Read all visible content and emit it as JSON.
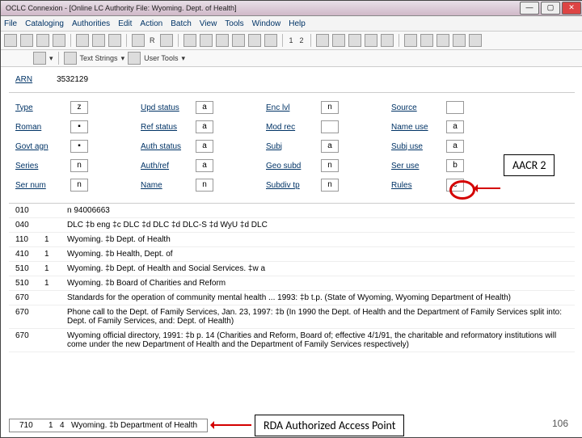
{
  "titlebar": {
    "text": "OCLC Connexion - [Online LC Authority File: Wyoming. Dept. of Health]"
  },
  "menu": {
    "file": "File",
    "cataloging": "Cataloging",
    "authorities": "Authorities",
    "edit": "Edit",
    "action": "Action",
    "batch": "Batch",
    "view": "View",
    "tools": "Tools",
    "window": "Window",
    "help": "Help"
  },
  "toolbar_nums": {
    "one": "1",
    "two": "2"
  },
  "toolbar2": {
    "textstrings": "Text Strings",
    "usertools": "User Tools"
  },
  "arn": {
    "label": "ARN",
    "value": "3532129"
  },
  "ff": {
    "r1": {
      "c1l": "Type",
      "c1v": "z",
      "c2l": "Upd status",
      "c2v": "a",
      "c3l": "Enc lvl",
      "c3v": "n",
      "c4l": "Source",
      "c4v": ""
    },
    "r2": {
      "c1l": "Roman",
      "c1v": "▪",
      "c2l": "Ref status",
      "c2v": "a",
      "c3l": "Mod rec",
      "c3v": "",
      "c4l": "Name use",
      "c4v": "a"
    },
    "r3": {
      "c1l": "Govt agn",
      "c1v": "▪",
      "c2l": "Auth status",
      "c2v": "a",
      "c3l": "Subj",
      "c3v": "a",
      "c4l": "Subj use",
      "c4v": "a"
    },
    "r4": {
      "c1l": "Series",
      "c1v": "n",
      "c2l": "Auth/ref",
      "c2v": "a",
      "c3l": "Geo subd",
      "c3v": "n",
      "c4l": "Ser use",
      "c4v": "b"
    },
    "r5": {
      "c1l": "Ser num",
      "c1v": "n",
      "c2l": "Name",
      "c2v": "n",
      "c3l": "Subdiv tp",
      "c3v": "n",
      "c4l": "Rules",
      "c4v": "c"
    }
  },
  "marc": [
    {
      "tag": "010",
      "i1": "",
      "i2": "",
      "data": "n  94006663"
    },
    {
      "tag": "040",
      "i1": "",
      "i2": "",
      "data": "DLC ‡b eng ‡c DLC ‡d DLC ‡d DLC-S ‡d WyU ‡d DLC"
    },
    {
      "tag": "110",
      "i1": "1",
      "i2": "",
      "data": "Wyoming. ‡b Dept. of Health"
    },
    {
      "tag": "410",
      "i1": "1",
      "i2": "",
      "data": "Wyoming. ‡b Health, Dept. of"
    },
    {
      "tag": "510",
      "i1": "1",
      "i2": "",
      "data": "Wyoming. ‡b Dept. of Health and Social Services. ‡w a"
    },
    {
      "tag": "510",
      "i1": "1",
      "i2": "",
      "data": "Wyoming. ‡b Board of Charities and Reform"
    },
    {
      "tag": "670",
      "i1": "",
      "i2": "",
      "data": "Standards for the operation of community mental health ... 1993: ‡b t.p. (State of Wyoming, Wyoming Department of Health)"
    },
    {
      "tag": "670",
      "i1": "",
      "i2": "",
      "data": "Phone call to the Dept. of Family Services, Jan. 23, 1997: ‡b (In 1990 the Dept. of Health and the Department of Family Services split into: Dept. of Family Services, and: Dept. of Health)"
    },
    {
      "tag": "670",
      "i1": "",
      "i2": "",
      "data": "Wyoming official directory, 1991: ‡b p. 14 (Charities and Reform, Board of; effective 4/1/91, the charitable and reformatory institutions will come under the new Department of Health and the Department of Family Services respectively)"
    }
  ],
  "bottom": {
    "tag": "710",
    "i1": "1",
    "i2": "4",
    "data": "Wyoming. ‡b Department of Health"
  },
  "callouts": {
    "aacr2": "AACR 2",
    "rda": "RDA Authorized Access Point"
  },
  "pagenum": "106"
}
